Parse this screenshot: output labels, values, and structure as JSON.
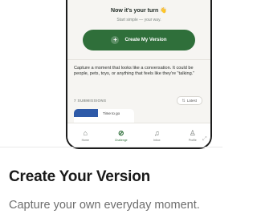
{
  "prompt": {
    "title": "Now it's your turn",
    "hand_emoji": "👋",
    "subtitle": "Start simple — your way.",
    "button_label": "Create My Version"
  },
  "description": "Capture a moment that looks like a conversation. It could be people, pets, toys, or anything that feels like they're \"talking.\"",
  "submissions": {
    "label": "7 SUBMISSIONS",
    "sort_label": "Latest",
    "first_card_title": "Time to go"
  },
  "tabbar": {
    "items": [
      {
        "label": "Home",
        "icon": "home-icon",
        "glyph": "⌂"
      },
      {
        "label": "Challenge",
        "icon": "challenge-check-icon",
        "glyph": "⊘"
      },
      {
        "label": "Inbox",
        "icon": "bell-icon",
        "glyph": "♫"
      },
      {
        "label": "Profile",
        "icon": "profile-icon",
        "glyph": "♙"
      }
    ]
  },
  "page": {
    "title": "Create Your Version",
    "subtitle": "Capture your own everyday moment."
  },
  "colors": {
    "accent": "#2f6f3a",
    "thumbnail": "#2e5aa8"
  }
}
